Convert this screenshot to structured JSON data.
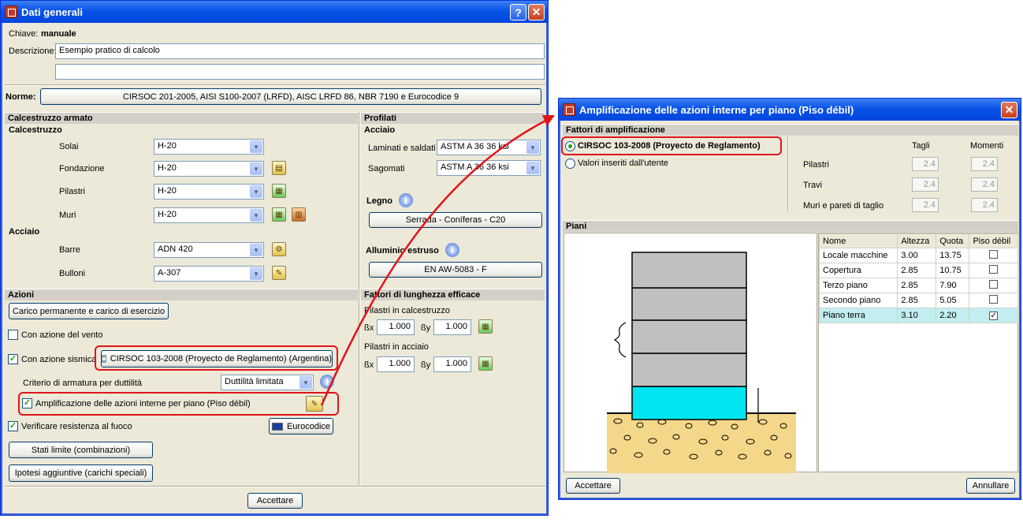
{
  "win1": {
    "title": "Dati generali",
    "chiave_label": "Chiave:",
    "chiave_value": "manuale",
    "descrizione_label": "Descrizione:",
    "descrizione_value": "Esempio pratico di calcolo",
    "descrizione_value2": "",
    "norme_label": "Norme:",
    "norme_button": "CIRSOC 201-2005, AISI S100-2007 (LRFD), AISC LRFD 86, NBR 7190 e Eurocodice 9",
    "calc_armato": {
      "header": "Calcestruzzo armato",
      "calcestruzzo": "Calcestruzzo",
      "rows": [
        {
          "label": "Solai",
          "value": "H-20"
        },
        {
          "label": "Fondazione",
          "value": "H-20"
        },
        {
          "label": "Pilastri",
          "value": "H-20"
        },
        {
          "label": "Muri",
          "value": "H-20"
        }
      ],
      "acciaio": "Acciaio",
      "acciaio_rows": [
        {
          "label": "Barre",
          "value": "ADN 420"
        },
        {
          "label": "Bulloni",
          "value": "A-307"
        }
      ]
    },
    "profilati": {
      "header": "Profilati",
      "acciaio": "Acciaio",
      "laminati_label": "Laminati e saldati",
      "laminati_value": "ASTM A 36  36 ksi",
      "sagomati_label": "Sagomati",
      "sagomati_value": "ASTM A 36  36 ksi",
      "legno_label": "Legno",
      "legno_button": "Serrada - Coníferas - C20",
      "alluminio_label": "Alluminio estruso",
      "alluminio_button": "EN AW-5083 - F"
    },
    "azioni": {
      "header": "Azioni",
      "carico_button": "Carico permanente e carico di esercizio",
      "vento_label": "Con azione del vento",
      "vento_checked": false,
      "sismica_label": "Con azione sismica",
      "sismica_checked": true,
      "sismica_button": "CIRSOC 103-2008 (Proyecto de Reglamento) (Argentina)",
      "criterio_label": "Criterio di armatura per duttilità",
      "criterio_value": "Duttilità limitata",
      "amplificazione_label": "Amplificazione delle azioni interne per piano (Piso débil)",
      "amplificazione_checked": true,
      "fuoco_label": "Verificare resistenza al fuoco",
      "fuoco_checked": true,
      "eurocodice_button": "Eurocodice",
      "stati_button": "Stati limite (combinazioni)",
      "ipotesi_button": "Ipotesi aggiuntive (carichi speciali)"
    },
    "fattori": {
      "header": "Fattori di lunghezza efficace",
      "calc_label": "Pilastri in calcestruzzo",
      "bx_label": "ßx",
      "by_label": "ßy",
      "calc_bx": "1.000",
      "calc_by": "1.000",
      "acciaio_label": "Pilastri in acciaio",
      "acc_bx": "1.000",
      "acc_by": "1.000"
    },
    "accettare": "Accettare"
  },
  "win2": {
    "title": "Amplificazione delle azioni interne per piano (Piso débil)",
    "fattori_header": "Fattori di amplificazione",
    "radio1_label": "CIRSOC 103-2008 (Proyecto de Reglamento)",
    "radio2_label": "Valori inseriti dall'utente",
    "col_tagli": "Tagli",
    "col_momenti": "Momenti",
    "rows": [
      {
        "label": "Pilastri",
        "tagli": "2.4",
        "momenti": "2.4"
      },
      {
        "label": "Travi",
        "tagli": "2.4",
        "momenti": "2.4"
      },
      {
        "label": "Muri e pareti di taglio",
        "tagli": "2.4",
        "momenti": "2.4"
      }
    ],
    "piani_header": "Piani",
    "table_headers": [
      "Nome",
      "Altezza",
      "Quota",
      "Piso débil"
    ],
    "table_rows": [
      {
        "nome": "Locale macchine",
        "altezza": "3.00",
        "quota": "13.75",
        "piso_debil": false
      },
      {
        "nome": "Copertura",
        "altezza": "2.85",
        "quota": "10.75",
        "piso_debil": false
      },
      {
        "nome": "Terzo piano",
        "altezza": "2.85",
        "quota": "7.90",
        "piso_debil": false
      },
      {
        "nome": "Secondo piano",
        "altezza": "2.85",
        "quota": "5.05",
        "piso_debil": false
      },
      {
        "nome": "Piano terra",
        "altezza": "3.10",
        "quota": "2.20",
        "piso_debil": true
      }
    ],
    "accettare": "Accettare",
    "annullare": "Annullare"
  },
  "colors": {
    "titlebar": "#0a53e6",
    "highlight": "#e0141a",
    "weak_floor": "#00e5f0",
    "floor_grey": "#c0c0c0",
    "ground": "#f5d78a"
  }
}
